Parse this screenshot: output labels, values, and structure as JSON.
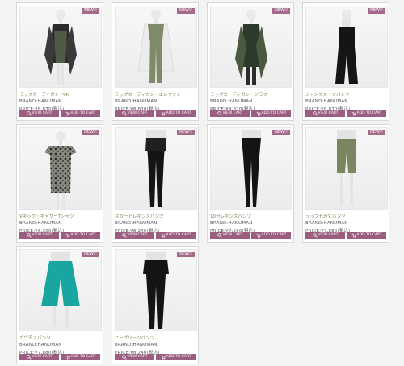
{
  "products": [
    {
      "badge": "NEW!!",
      "name": "ラップカーディガン ペ4(",
      "brand": "BRAND:HANUMAN",
      "price": "PRICE:¥8,870(税込)",
      "view_label": "VIEW CART",
      "cart_label": "ADD TO CART"
    },
    {
      "badge": "NEW!!",
      "name": "ラップカーディガン・エレファント",
      "brand": "BRAND:HANUMAN",
      "price": "PRICE:¥8,870(税込)",
      "view_label": "VIEW CART",
      "cart_label": "ADD TO CART"
    },
    {
      "badge": "NEW!!",
      "name": "ラップカーディガン・ジラフ",
      "brand": "BRAND:HANUMAN",
      "price": "PRICE:¥8,870(税込)",
      "view_label": "VIEW CART",
      "cart_label": "ADD TO CART"
    },
    {
      "badge": "NEW!!",
      "name": "ジャンプスーツパンツ",
      "brand": "BRAND:HANUMAN",
      "price": "PRICE:¥8,870(税込)",
      "view_label": "VIEW CART",
      "cart_label": "ADD TO CART"
    },
    {
      "badge": "NEW!!",
      "name": "Vネック・ギャザーTシャツ",
      "brand": "BRAND:HANUMAN",
      "price": "PRICE:¥6,300(税込)",
      "view_label": "VIEW CART",
      "cart_label": "ADD TO CART"
    },
    {
      "badge": "NEW!!",
      "name": "スカートレギンスパンツ",
      "brand": "BRAND:HANUMAN",
      "price": "PRICE:¥8,240(税込)",
      "view_label": "VIEW CART",
      "cart_label": "ADD TO CART"
    },
    {
      "badge": "NEW!!",
      "name": "10分レギンスパンツ",
      "brand": "BRAND:HANUMAN",
      "price": "PRICE:¥7,560(税込)",
      "view_label": "VIEW CART",
      "cart_label": "ADD TO CART"
    },
    {
      "badge": "NEW!!",
      "name": "ラップ七分丈パンツ",
      "brand": "BRAND:HANUMAN",
      "price": "PRICE:¥7,880(税込)",
      "view_label": "VIEW CART",
      "cart_label": "ADD TO CART"
    },
    {
      "badge": "NEW!!",
      "name": "ガウチョパンツ",
      "brand": "BRAND:HANUMAN",
      "price": "PRICE:¥7,880(税込)",
      "view_label": "VIEW CART",
      "cart_label": "ADD TO CART"
    },
    {
      "badge": "NEW!!",
      "name": "ニーブリーツパンツ",
      "brand": "BRAND:HANUMAN",
      "price": "PRICE:¥8,240(税込)",
      "view_label": "VIEW CART",
      "cart_label": "ADD TO CART"
    }
  ],
  "colors": {
    "badge": "#a56a8a",
    "button": "#9b5d80",
    "name_text": "#6e8b55"
  }
}
